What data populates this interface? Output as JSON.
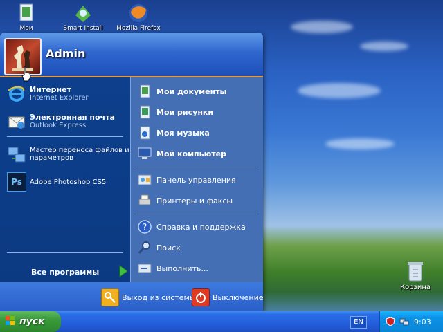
{
  "desktop": {
    "icons": [
      {
        "label": "Мои",
        "icon": "my-documents-icon"
      },
      {
        "label": "Smart Install",
        "icon": "smart-install-icon"
      },
      {
        "label": "Mozilla Firefox",
        "icon": "firefox-icon"
      }
    ],
    "recycle_bin": {
      "label": "Корзина",
      "icon": "recycle-bin-icon"
    }
  },
  "start_menu": {
    "user": {
      "name": "Admin",
      "avatar": "chess-avatar-icon"
    },
    "pinned": [
      {
        "title": "Интернет",
        "subtitle": "Internet Explorer",
        "icon": "internet-explorer-icon"
      },
      {
        "title": "Электронная почта",
        "subtitle": "Outlook Express",
        "icon": "outlook-express-icon"
      }
    ],
    "recent": [
      {
        "label": "Мастер переноса файлов и",
        "label2": "параметров",
        "icon": "transfer-wizard-icon"
      },
      {
        "label": "Adobe Photoshop CS5",
        "icon": "photoshop-icon"
      }
    ],
    "all_programs": {
      "label": "Все программы",
      "icon": "green-arrow-icon"
    },
    "right_items_bold": [
      {
        "label": "Мои документы",
        "icon": "my-documents-icon"
      },
      {
        "label": "Мои рисунки",
        "icon": "my-pictures-icon"
      },
      {
        "label": "Моя музыка",
        "icon": "my-music-icon"
      },
      {
        "label": "Мой компьютер",
        "icon": "my-computer-icon"
      }
    ],
    "right_items_system": [
      {
        "label": "Панель управления",
        "icon": "control-panel-icon"
      },
      {
        "label": "Принтеры и факсы",
        "icon": "printers-icon"
      }
    ],
    "right_items_help": [
      {
        "label": "Справка и поддержка",
        "icon": "help-icon"
      },
      {
        "label": "Поиск",
        "icon": "search-icon"
      },
      {
        "label": "Выполнить...",
        "icon": "run-icon"
      }
    ],
    "bottom": {
      "logoff_label": "Выход из системы",
      "shutdown_label": "Выключение"
    }
  },
  "taskbar": {
    "start_label": "пуск",
    "language": "EN",
    "clock": "9:03"
  }
}
